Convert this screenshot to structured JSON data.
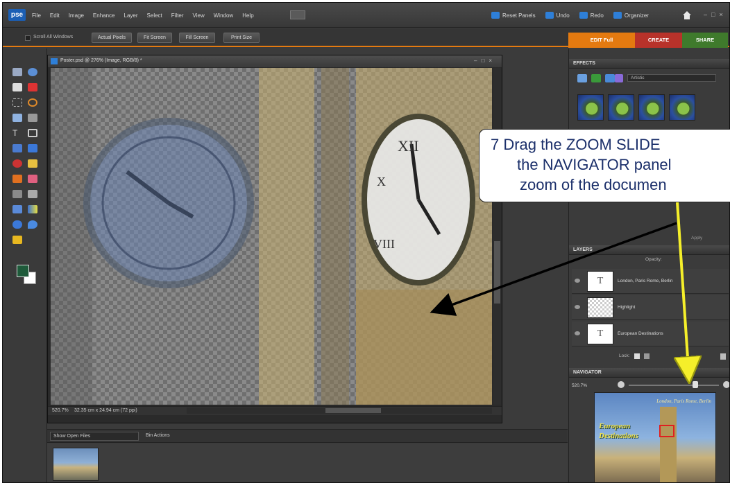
{
  "menubar": {
    "logo": "pse",
    "menus": [
      "File",
      "Edit",
      "Image",
      "Enhance",
      "Layer",
      "Select",
      "Filter",
      "View",
      "Window",
      "Help"
    ],
    "reset_panels": "Reset Panels",
    "undo": "Undo",
    "redo": "Redo",
    "organizer": "Organizer"
  },
  "optbar": {
    "scroll_all": "Scroll All Windows",
    "actual_pixels": "Actual Pixels",
    "fit_screen": "Fit Screen",
    "fill_screen": "Fill Screen",
    "print_size": "Print Size"
  },
  "tabs": {
    "edit": "EDIT Full",
    "create": "CREATE",
    "share": "SHARE"
  },
  "document": {
    "title": "Poster.psd @ 276% (Image, RGB/8) *",
    "zoom": "520.7%",
    "size": "32.35 cm x 24.94 cm (72 ppi)"
  },
  "bin": {
    "show_open": "Show Open Files",
    "actions": "Bin Actions"
  },
  "effects": {
    "header": "EFFECTS",
    "category": "Artistic",
    "apply": "Apply"
  },
  "layers": {
    "header": "LAYERS",
    "opacity": "Opacity:",
    "lock": "Lock:",
    "items": [
      {
        "name": "London, Paris Rome, Berlin",
        "glyph": "T"
      },
      {
        "name": "Highlight",
        "glyph": ""
      },
      {
        "name": "European Destinations",
        "glyph": "T"
      }
    ]
  },
  "navigator": {
    "header": "NAVIGATOR",
    "zoom": "520.7%",
    "thumb_title_1": "European",
    "thumb_title_2": "Destinations",
    "thumb_cities": "London, Paris Rome, Berlin"
  },
  "callout": {
    "line1": "7  Drag the ZOOM SLIDE",
    "line2": "the NAVIGATOR panel",
    "line3": "zoom of the documen"
  },
  "colors": {
    "accent_orange": "#e47a10",
    "callout_text": "#1b2f6a",
    "arrow_yellow": "#f5ef2a"
  }
}
